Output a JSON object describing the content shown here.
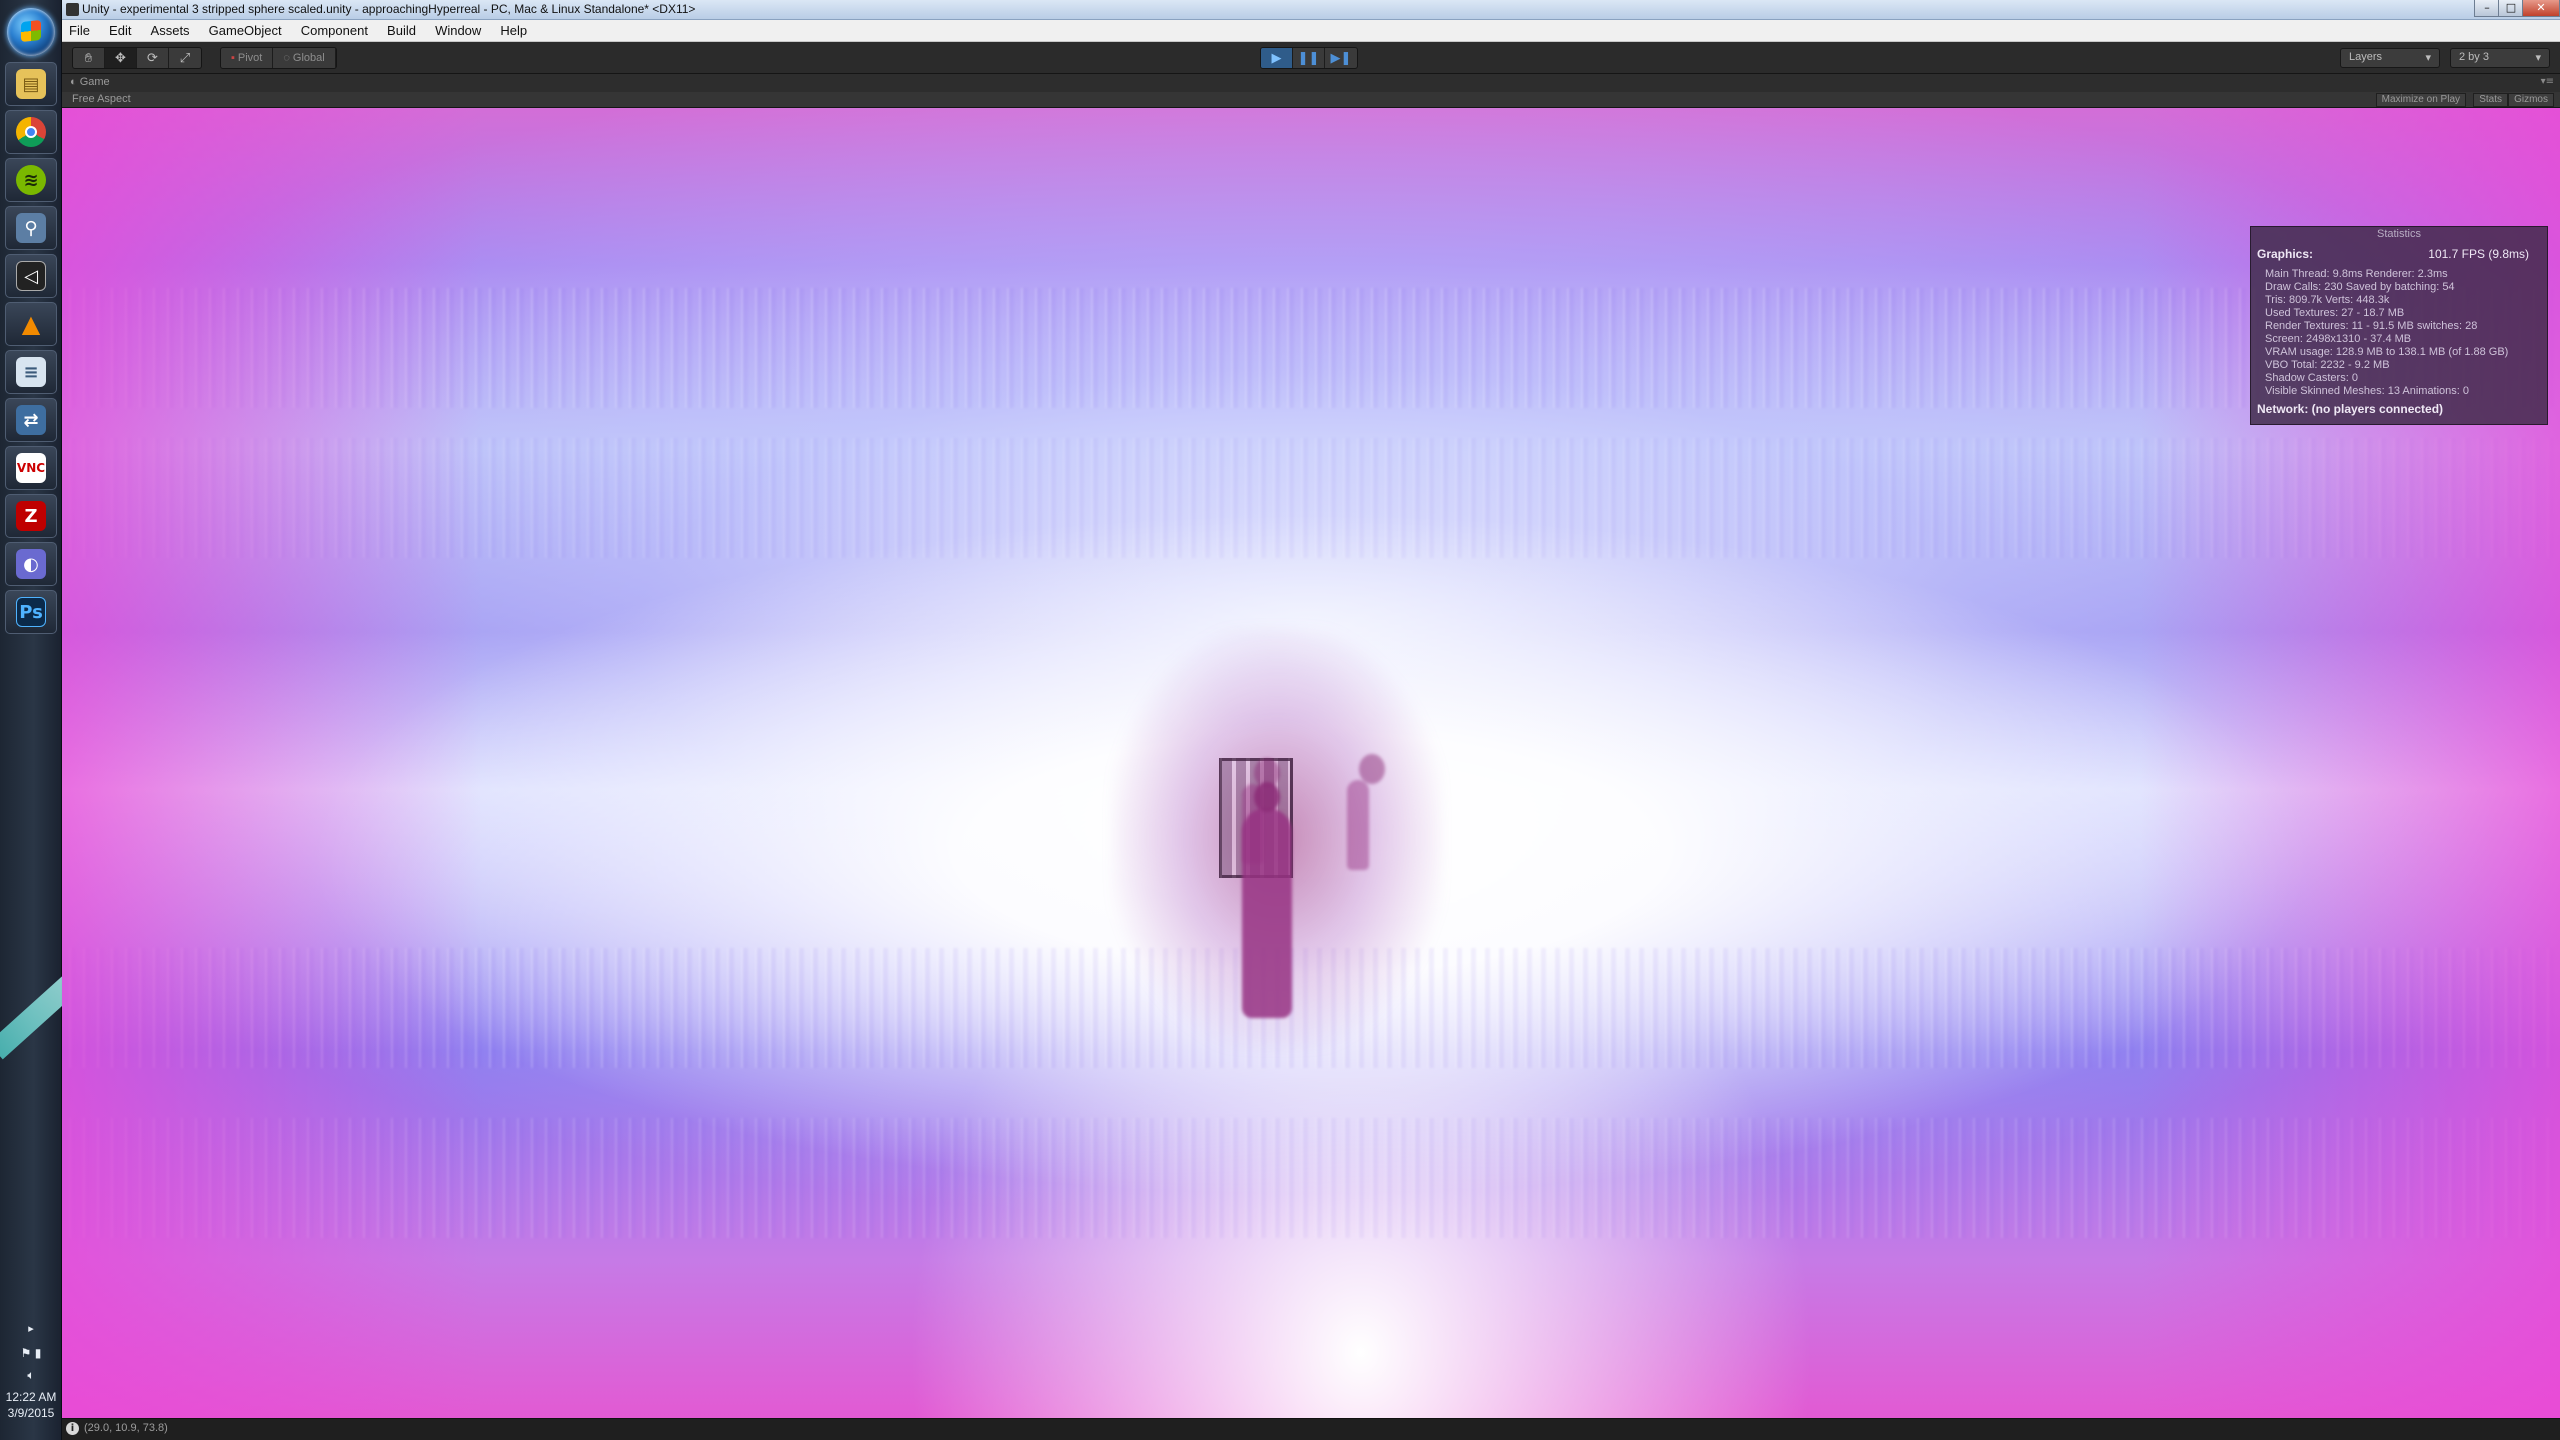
{
  "window": {
    "title": "Unity - experimental 3 stripped sphere scaled.unity - approachingHyperreal - PC, Mac & Linux Standalone* <DX11>",
    "controls": {
      "minimize": "–",
      "maximize": "□",
      "close": "✕"
    }
  },
  "menu": [
    "File",
    "Edit",
    "Assets",
    "GameObject",
    "Component",
    "Build",
    "Window",
    "Help"
  ],
  "toolbar": {
    "tools": [
      "hand-icon",
      "move-icon",
      "rotate-icon",
      "scale-icon"
    ],
    "pivot_label": "Pivot",
    "global_label": "Global",
    "play_state": "playing",
    "layers_label": "Layers",
    "layout_label": "2 by 3"
  },
  "game_panel": {
    "tab_label": "Game",
    "aspect_label": "Free Aspect",
    "maximize_label": "Maximize on Play",
    "stats_label": "Stats",
    "gizmos_label": "Gizmos"
  },
  "statistics": {
    "header": "Statistics",
    "graphics_label": "Graphics:",
    "fps": "101.7 FPS (9.8ms)",
    "lines": [
      "Main Thread: 9.8ms   Renderer: 2.3ms",
      "Draw Calls: 230    Saved by batching: 54",
      "Tris: 809.7k      Verts: 448.3k",
      "Used Textures: 27 - 18.7 MB",
      "Render Textures: 11 - 91.5 MB   switches: 28",
      "Screen: 2498x1310 - 37.4 MB",
      "VRAM usage: 128.9 MB to 138.1 MB (of 1.88 GB)",
      "VBO Total: 2232 - 9.2 MB",
      "Shadow Casters: 0",
      "Visible Skinned Meshes: 13     Animations: 0"
    ],
    "network": "Network: (no players connected)"
  },
  "statusbar": {
    "message": "(29.0, 10.9, 73.8)"
  },
  "taskbar": {
    "pins": [
      "explorer-icon",
      "chrome-icon",
      "spotify-icon",
      "remote-icon",
      "unity-icon",
      "vlc-icon",
      "notepad-icon",
      "network-icon",
      "vnc-icon",
      "filezilla-icon",
      "app-icon",
      "photoshop-icon"
    ],
    "time": "12:22 AM",
    "date": "3/9/2015"
  }
}
